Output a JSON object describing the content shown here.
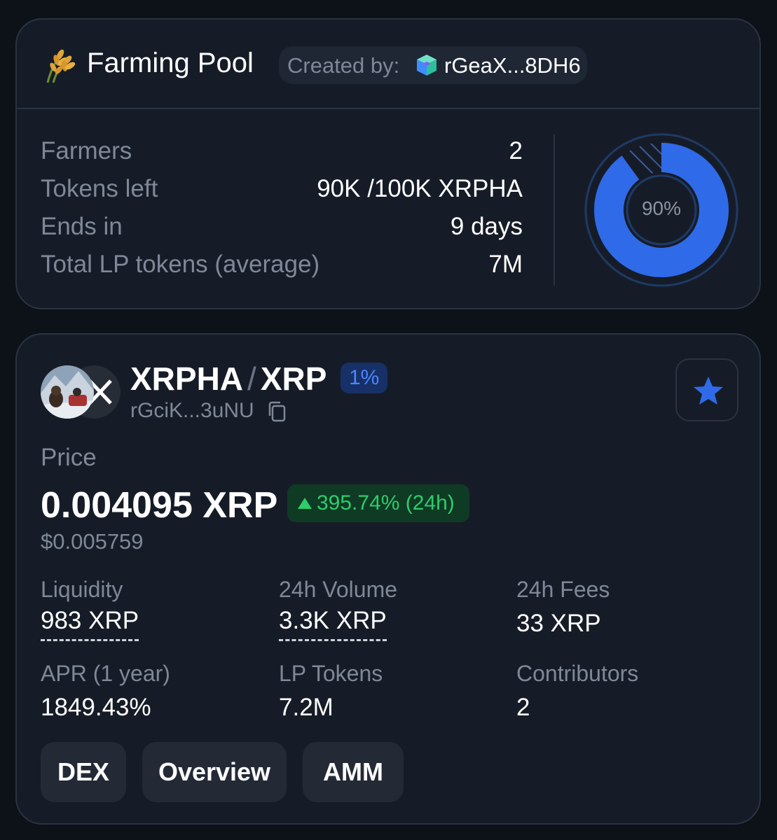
{
  "farming_pool": {
    "title": "Farming Pool",
    "title_icon": "wheat-icon",
    "created_by_label": "Created by:",
    "creator_icon": "cube-icon",
    "creator_address": "rGeaX...8DH6",
    "stats": [
      {
        "label": "Farmers",
        "value": "2"
      },
      {
        "label": "Tokens left",
        "value": "90K /100K XRPHA"
      },
      {
        "label": "Ends in",
        "value": "9 days"
      },
      {
        "label": "Total LP tokens (average)",
        "value": "7M"
      }
    ],
    "progress_percent": 90,
    "progress_label": "90%"
  },
  "pool": {
    "base_token": "XRPHA",
    "separator": "/",
    "quote_token": "XRP",
    "fee_badge": "1%",
    "address": "rGciK...3uNU",
    "price_label": "Price",
    "price_value": "0.004095 XRP",
    "price_change": "395.74% (24h)",
    "price_usd": "$0.005759",
    "metrics": [
      {
        "label": "Liquidity",
        "value": "983 XRP"
      },
      {
        "label": "24h Volume",
        "value": "3.3K XRP"
      },
      {
        "label": "24h Fees",
        "value": "33 XRP"
      },
      {
        "label": "APR (1 year)",
        "value": "1849.43%"
      },
      {
        "label": "LP Tokens",
        "value": "7.2M"
      },
      {
        "label": "Contributors",
        "value": "2"
      }
    ],
    "buttons": [
      {
        "label": "DEX"
      },
      {
        "label": "Overview"
      },
      {
        "label": "AMM"
      }
    ]
  },
  "colors": {
    "accent_blue": "#2f6ae8",
    "positive_green": "#2ecc6a",
    "background": "#0d1118",
    "card": "#161c27"
  }
}
